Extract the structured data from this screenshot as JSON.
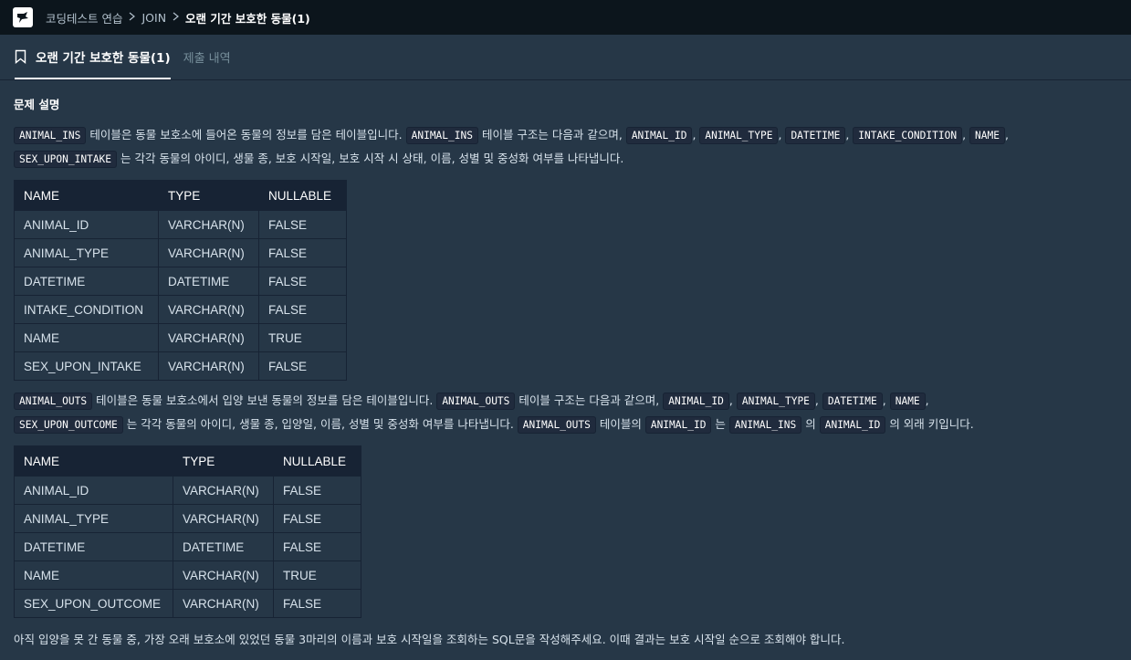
{
  "breadcrumb": [
    "코딩테스트 연습",
    "JOIN",
    "오랜 기간 보호한 동물(1)"
  ],
  "tabs": {
    "active": "오랜 기간 보호한 동물(1)",
    "inactive": "제출 내역"
  },
  "heading": "문제 설명",
  "para1": {
    "line1": [
      {
        "code": "ANIMAL_INS"
      },
      {
        "text": " 테이블은 동물 보호소에 들어온 동물의 정보를 담은 테이블입니다. "
      },
      {
        "code": "ANIMAL_INS"
      },
      {
        "text": " 테이블 구조는 다음과 같으며, "
      },
      {
        "code": "ANIMAL_ID"
      },
      {
        "text": ", "
      },
      {
        "code": "ANIMAL_TYPE"
      },
      {
        "text": ", "
      },
      {
        "code": "DATETIME"
      },
      {
        "text": ", "
      },
      {
        "code": "INTAKE_CONDITION"
      },
      {
        "text": ", "
      },
      {
        "code": "NAME"
      },
      {
        "text": ","
      }
    ],
    "line2": [
      {
        "code": "SEX_UPON_INTAKE"
      },
      {
        "text": " 는 각각 동물의 아이디, 생물 종, 보호 시작일, 보호 시작 시 상태, 이름, 성별 및 중성화 여부를 나타냅니다."
      }
    ]
  },
  "table1": {
    "headers": [
      "NAME",
      "TYPE",
      "NULLABLE"
    ],
    "rows": [
      [
        "ANIMAL_ID",
        "VARCHAR(N)",
        "FALSE"
      ],
      [
        "ANIMAL_TYPE",
        "VARCHAR(N)",
        "FALSE"
      ],
      [
        "DATETIME",
        "DATETIME",
        "FALSE"
      ],
      [
        "INTAKE_CONDITION",
        "VARCHAR(N)",
        "FALSE"
      ],
      [
        "NAME",
        "VARCHAR(N)",
        "TRUE"
      ],
      [
        "SEX_UPON_INTAKE",
        "VARCHAR(N)",
        "FALSE"
      ]
    ]
  },
  "para2": {
    "line1": [
      {
        "code": "ANIMAL_OUTS"
      },
      {
        "text": " 테이블은 동물 보호소에서 입양 보낸 동물의 정보를 담은 테이블입니다. "
      },
      {
        "code": "ANIMAL_OUTS"
      },
      {
        "text": " 테이블 구조는 다음과 같으며, "
      },
      {
        "code": "ANIMAL_ID"
      },
      {
        "text": ", "
      },
      {
        "code": "ANIMAL_TYPE"
      },
      {
        "text": ", "
      },
      {
        "code": "DATETIME"
      },
      {
        "text": ", "
      },
      {
        "code": "NAME"
      },
      {
        "text": ","
      }
    ],
    "line2": [
      {
        "code": "SEX_UPON_OUTCOME"
      },
      {
        "text": " 는 각각 동물의 아이디, 생물 종, 입양일, 이름, 성별 및 중성화 여부를 나타냅니다. "
      },
      {
        "code": "ANIMAL_OUTS"
      },
      {
        "text": " 테이블의 "
      },
      {
        "code": "ANIMAL_ID"
      },
      {
        "text": " 는 "
      },
      {
        "code": "ANIMAL_INS"
      },
      {
        "text": " 의 "
      },
      {
        "code": "ANIMAL_ID"
      },
      {
        "text": " 의 외래 키입니다."
      }
    ]
  },
  "table2": {
    "headers": [
      "NAME",
      "TYPE",
      "NULLABLE"
    ],
    "rows": [
      [
        "ANIMAL_ID",
        "VARCHAR(N)",
        "FALSE"
      ],
      [
        "ANIMAL_TYPE",
        "VARCHAR(N)",
        "FALSE"
      ],
      [
        "DATETIME",
        "DATETIME",
        "FALSE"
      ],
      [
        "NAME",
        "VARCHAR(N)",
        "TRUE"
      ],
      [
        "SEX_UPON_OUTCOME",
        "VARCHAR(N)",
        "FALSE"
      ]
    ]
  },
  "question": "아직 입양을 못 간 동물 중, 가장 오래 보호소에 있었던 동물 3마리의 이름과 보호 시작일을 조회하는 SQL문을 작성해주세요. 이때 결과는 보호 시작일 순으로 조회해야 합니다.",
  "colors": {
    "topbar": "#0c151c",
    "background": "#263747",
    "code_bg": "#202b3d",
    "table_header": "#172334"
  },
  "icons": [
    "programmers-logo-icon",
    "chevron-right-icon",
    "bookmark-icon"
  ]
}
